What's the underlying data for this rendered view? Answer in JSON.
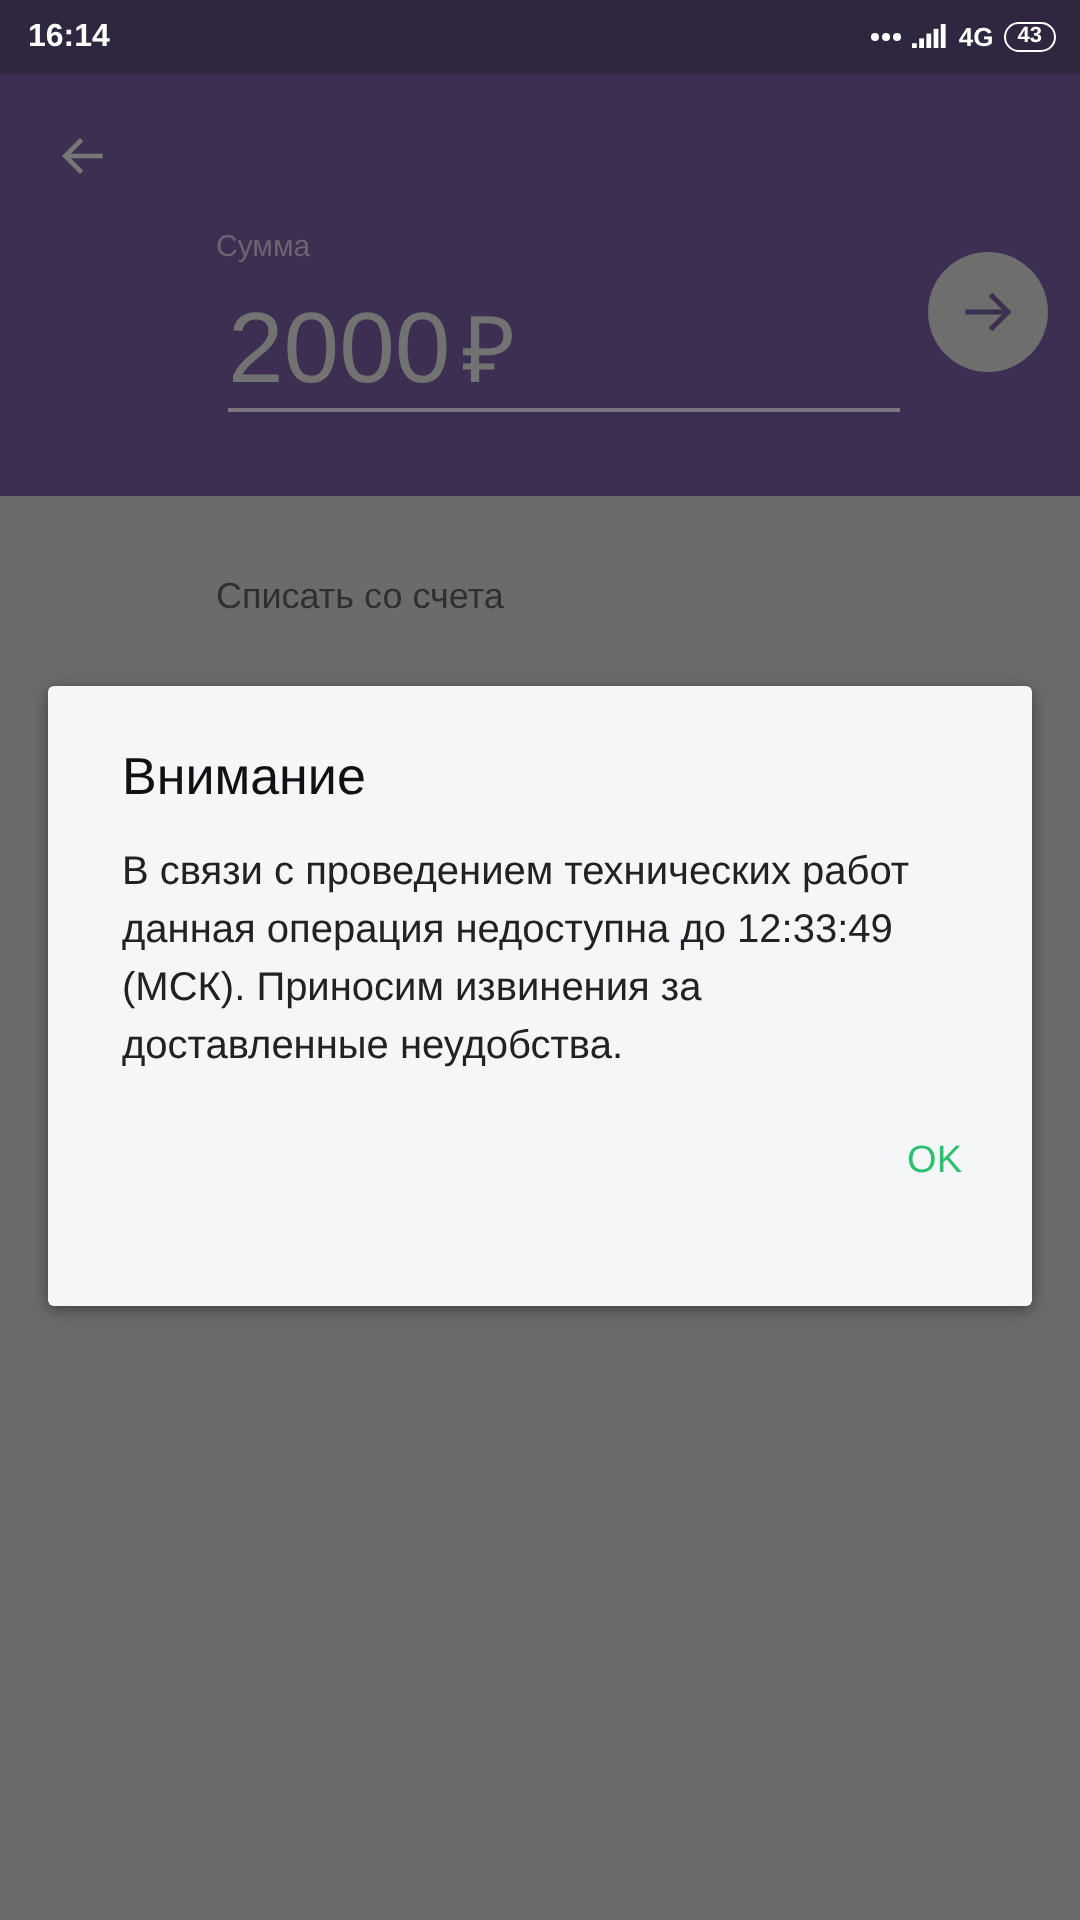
{
  "status_bar": {
    "time": "16:14",
    "network": "4G",
    "battery": "43"
  },
  "header": {
    "amount_label": "Сумма",
    "amount": "2000",
    "currency": "₽"
  },
  "account": {
    "label": "Списать со счета"
  },
  "dialog": {
    "title": "Внимание",
    "message": "В связи с проведением технических работ данная операция недоступна до 12:33:49 (МСК). Приносим извинения за доставленные неудобства.",
    "buttons": [
      "OK"
    ]
  }
}
